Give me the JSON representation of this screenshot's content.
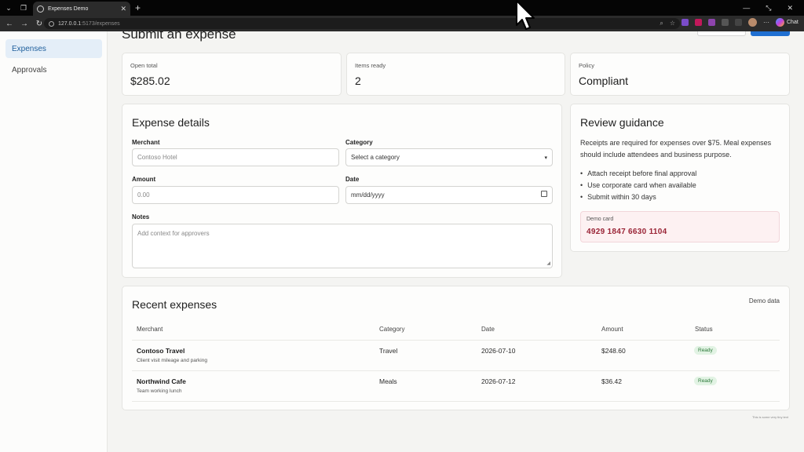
{
  "browser": {
    "tab_title": "Expenses Demo",
    "url_host": "127.0.0.1",
    "url_rest": ":5173/expenses",
    "copilot_label": "Chat"
  },
  "sidebar": {
    "items": [
      {
        "label": "Expenses",
        "active": true
      },
      {
        "label": "Approvals",
        "active": false
      }
    ]
  },
  "header": {
    "title": "Submit an expense"
  },
  "stats": [
    {
      "label": "Open total",
      "value": "$285.02"
    },
    {
      "label": "Items ready",
      "value": "2"
    },
    {
      "label": "Policy",
      "value": "Compliant"
    }
  ],
  "form": {
    "title": "Expense details",
    "merchant_label": "Merchant",
    "merchant_placeholder": "Contoso Hotel",
    "category_label": "Category",
    "category_value": "Select a category",
    "amount_label": "Amount",
    "amount_placeholder": "0.00",
    "date_label": "Date",
    "date_placeholder": "mm/dd/yyyy",
    "notes_label": "Notes",
    "notes_placeholder": "Add context for approvers"
  },
  "guidance": {
    "title": "Review guidance",
    "text": "Receipts are required for expenses over $75. Meal expenses should include attendees and business purpose.",
    "bullets": [
      "Attach receipt before final approval",
      "Use corporate card when available",
      "Submit within 30 days"
    ],
    "demo_card_label": "Demo card",
    "demo_card_number": "4929 1847 6630 1104"
  },
  "recent": {
    "title": "Recent expenses",
    "tag": "Demo data",
    "columns": [
      "Merchant",
      "Category",
      "Date",
      "Amount",
      "Status"
    ],
    "rows": [
      {
        "merchant": "Contoso Travel",
        "note": "Client visit mileage and parking",
        "category": "Travel",
        "date": "2026-07-10",
        "amount": "$248.60",
        "status": "Ready"
      },
      {
        "merchant": "Northwind Cafe",
        "note": "Team working lunch",
        "category": "Meals",
        "date": "2026-07-12",
        "amount": "$36.42",
        "status": "Ready"
      }
    ]
  },
  "footer_text": "This is some very tiny text",
  "colors": {
    "accent": "#1f6fd1",
    "active_nav_bg": "#e4eef8",
    "demo_card_bg": "#fdf1f2",
    "badge_green": "#2d7a3a"
  }
}
